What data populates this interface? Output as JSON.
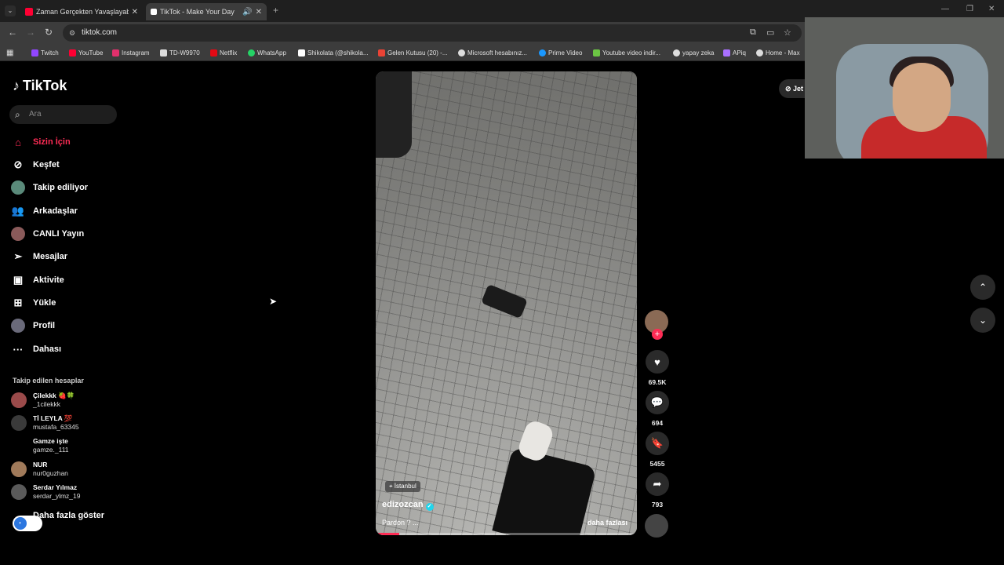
{
  "browser": {
    "tabs": [
      {
        "title": "Zaman Gerçekten Yavaşlayabilir",
        "favicon_color": "#ff0033",
        "active": false
      },
      {
        "title": "TikTok - Make Your Day",
        "favicon_color": "#ffffff",
        "active": true
      }
    ],
    "url": "tiktok.com",
    "bookmarks": [
      {
        "label": "Twitch",
        "icon_color": "#9146ff"
      },
      {
        "label": "YouTube",
        "icon_color": "#ff0033"
      },
      {
        "label": "Instagram",
        "icon_color": "#e1306c"
      },
      {
        "label": "TD-W9970",
        "icon_color": "#dddddd"
      },
      {
        "label": "Netflix",
        "icon_color": "#e50914"
      },
      {
        "label": "WhatsApp",
        "icon_color": "#25d366"
      },
      {
        "label": "Shikolata (@shikola...",
        "icon_color": "#ffffff"
      },
      {
        "label": "Gelen Kutusu (20) -...",
        "icon_color": "#ea4335"
      },
      {
        "label": "Microsoft hesabınız...",
        "icon_color": "#dddddd"
      },
      {
        "label": "Prime Video",
        "icon_color": "#1a98ff"
      },
      {
        "label": "Youtube video indir...",
        "icon_color": "#6cc644"
      },
      {
        "label": "yapay zeka",
        "icon_color": "#dddddd"
      },
      {
        "label": "APiq",
        "icon_color": "#a970ff"
      },
      {
        "label": "Home - Max",
        "icon_color": "#dddddd"
      }
    ]
  },
  "sidebar": {
    "logo": "TikTok",
    "search_placeholder": "Ara",
    "items": [
      {
        "label": "Sizin İçin",
        "icon": "home-icon",
        "active": true
      },
      {
        "label": "Keşfet",
        "icon": "compass-icon",
        "active": false
      },
      {
        "label": "Takip ediliyor",
        "icon": "following-avatar-icon",
        "active": false
      },
      {
        "label": "Arkadaşlar",
        "icon": "friends-icon",
        "active": false
      },
      {
        "label": "CANLI Yayın",
        "icon": "live-avatar-icon",
        "active": false
      },
      {
        "label": "Mesajlar",
        "icon": "send-icon",
        "active": false
      },
      {
        "label": "Aktivite",
        "icon": "activity-icon",
        "active": false
      },
      {
        "label": "Yükle",
        "icon": "upload-icon",
        "active": false
      },
      {
        "label": "Profil",
        "icon": "profile-avatar-icon",
        "active": false
      },
      {
        "label": "Dahası",
        "icon": "more-dots-icon",
        "active": false
      }
    ],
    "following_title": "Takip edilen hesaplar",
    "following": [
      {
        "name": "Çilekkk 🍓🍀",
        "user": "_1cilekkk"
      },
      {
        "name": "Tİ LEYLA 💯",
        "user": "mustafa_63345"
      },
      {
        "name": "Gamze işte",
        "user": "gamze._111"
      },
      {
        "name": "NUR",
        "user": "nur0guzhan"
      },
      {
        "name": "Serdar Yılmaz",
        "user": "serdar_ylmz_19"
      }
    ],
    "show_more": "Daha fazla göster"
  },
  "video": {
    "location": "İstanbul",
    "author": "edizozcan",
    "caption": "Pardon ? ...",
    "more": "daha fazlası",
    "progress": 0.09,
    "likes": "69.5K",
    "comments": "694",
    "saves": "5455",
    "shares": "793"
  },
  "get_app": "Jet",
  "colors": {
    "accent": "#fe2c55",
    "verified": "#20d5ec"
  }
}
